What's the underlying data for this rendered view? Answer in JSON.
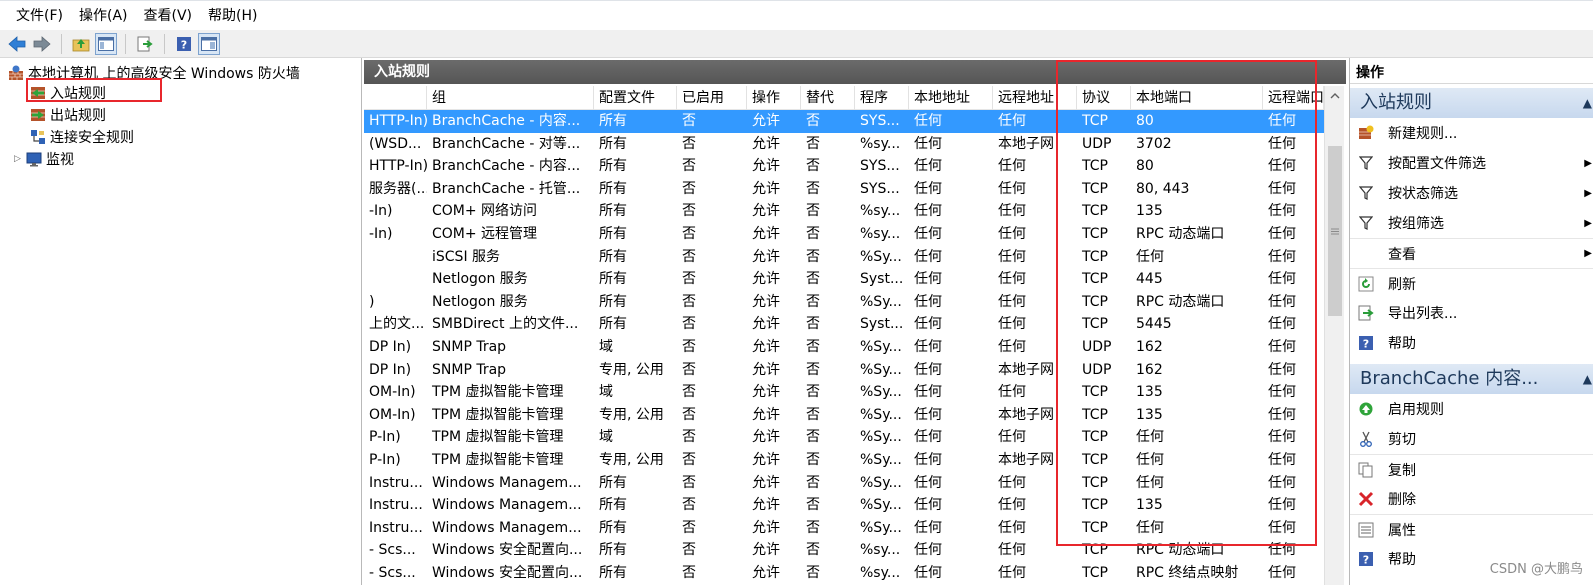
{
  "menubar": [
    "文件(F)",
    "操作(A)",
    "查看(V)",
    "帮助(H)"
  ],
  "tree": {
    "root": "本地计算机 上的高级安全 Windows 防火墙",
    "items": [
      "入站规则",
      "出站规则",
      "连接安全规则",
      "监视"
    ]
  },
  "center": {
    "title": "入站规则",
    "columns": [
      "组",
      "配置文件",
      "已启用",
      "操作",
      "替代",
      "程序",
      "本地地址",
      "远程地址",
      "协议",
      "本地端口",
      "远程端口"
    ],
    "rows": [
      {
        "name": "HTTP-In)",
        "group": "BranchCache - 内容...",
        "profile": "所有",
        "enabled": "否",
        "action": "允许",
        "override": "否",
        "program": "SYS...",
        "local_addr": "任何",
        "remote_addr": "任何",
        "protocol": "TCP",
        "local_port": "80",
        "remote_port": "任何",
        "selected": true
      },
      {
        "name": "(WSD...",
        "group": "BranchCache - 对等...",
        "profile": "所有",
        "enabled": "否",
        "action": "允许",
        "override": "否",
        "program": "%sy...",
        "local_addr": "任何",
        "remote_addr": "本地子网",
        "protocol": "UDP",
        "local_port": "3702",
        "remote_port": "任何"
      },
      {
        "name": "HTTP-In)",
        "group": "BranchCache - 内容...",
        "profile": "所有",
        "enabled": "否",
        "action": "允许",
        "override": "否",
        "program": "SYS...",
        "local_addr": "任何",
        "remote_addr": "任何",
        "protocol": "TCP",
        "local_port": "80",
        "remote_port": "任何"
      },
      {
        "name": "服务器(...",
        "group": "BranchCache - 托管...",
        "profile": "所有",
        "enabled": "否",
        "action": "允许",
        "override": "否",
        "program": "SYS...",
        "local_addr": "任何",
        "remote_addr": "任何",
        "protocol": "TCP",
        "local_port": "80, 443",
        "remote_port": "任何"
      },
      {
        "name": "-In)",
        "group": "COM+ 网络访问",
        "profile": "所有",
        "enabled": "否",
        "action": "允许",
        "override": "否",
        "program": "%sy...",
        "local_addr": "任何",
        "remote_addr": "任何",
        "protocol": "TCP",
        "local_port": "135",
        "remote_port": "任何"
      },
      {
        "name": "-In)",
        "group": "COM+ 远程管理",
        "profile": "所有",
        "enabled": "否",
        "action": "允许",
        "override": "否",
        "program": "%sy...",
        "local_addr": "任何",
        "remote_addr": "任何",
        "protocol": "TCP",
        "local_port": "RPC 动态端口",
        "remote_port": "任何"
      },
      {
        "name": "",
        "group": "iSCSI 服务",
        "profile": "所有",
        "enabled": "否",
        "action": "允许",
        "override": "否",
        "program": "%Sy...",
        "local_addr": "任何",
        "remote_addr": "任何",
        "protocol": "TCP",
        "local_port": "任何",
        "remote_port": "任何"
      },
      {
        "name": "",
        "group": "Netlogon 服务",
        "profile": "所有",
        "enabled": "否",
        "action": "允许",
        "override": "否",
        "program": "Syst...",
        "local_addr": "任何",
        "remote_addr": "任何",
        "protocol": "TCP",
        "local_port": "445",
        "remote_port": "任何"
      },
      {
        "name": ")",
        "group": "Netlogon 服务",
        "profile": "所有",
        "enabled": "否",
        "action": "允许",
        "override": "否",
        "program": "%Sy...",
        "local_addr": "任何",
        "remote_addr": "任何",
        "protocol": "TCP",
        "local_port": "RPC 动态端口",
        "remote_port": "任何"
      },
      {
        "name": "上的文...",
        "group": "SMBDirect 上的文件...",
        "profile": "所有",
        "enabled": "否",
        "action": "允许",
        "override": "否",
        "program": "Syst...",
        "local_addr": "任何",
        "remote_addr": "任何",
        "protocol": "TCP",
        "local_port": "5445",
        "remote_port": "任何"
      },
      {
        "name": "DP In)",
        "group": "SNMP Trap",
        "profile": "域",
        "enabled": "否",
        "action": "允许",
        "override": "否",
        "program": "%Sy...",
        "local_addr": "任何",
        "remote_addr": "任何",
        "protocol": "UDP",
        "local_port": "162",
        "remote_port": "任何"
      },
      {
        "name": "DP In)",
        "group": "SNMP Trap",
        "profile": "专用, 公用",
        "enabled": "否",
        "action": "允许",
        "override": "否",
        "program": "%Sy...",
        "local_addr": "任何",
        "remote_addr": "本地子网",
        "protocol": "UDP",
        "local_port": "162",
        "remote_port": "任何"
      },
      {
        "name": "OM-In)",
        "group": "TPM 虚拟智能卡管理",
        "profile": "域",
        "enabled": "否",
        "action": "允许",
        "override": "否",
        "program": "%Sy...",
        "local_addr": "任何",
        "remote_addr": "任何",
        "protocol": "TCP",
        "local_port": "135",
        "remote_port": "任何"
      },
      {
        "name": "OM-In)",
        "group": "TPM 虚拟智能卡管理",
        "profile": "专用, 公用",
        "enabled": "否",
        "action": "允许",
        "override": "否",
        "program": "%Sy...",
        "local_addr": "任何",
        "remote_addr": "本地子网",
        "protocol": "TCP",
        "local_port": "135",
        "remote_port": "任何"
      },
      {
        "name": "P-In)",
        "group": "TPM 虚拟智能卡管理",
        "profile": "域",
        "enabled": "否",
        "action": "允许",
        "override": "否",
        "program": "%Sy...",
        "local_addr": "任何",
        "remote_addr": "任何",
        "protocol": "TCP",
        "local_port": "任何",
        "remote_port": "任何"
      },
      {
        "name": "P-In)",
        "group": "TPM 虚拟智能卡管理",
        "profile": "专用, 公用",
        "enabled": "否",
        "action": "允许",
        "override": "否",
        "program": "%Sy...",
        "local_addr": "任何",
        "remote_addr": "本地子网",
        "protocol": "TCP",
        "local_port": "任何",
        "remote_port": "任何"
      },
      {
        "name": "Instru...",
        "group": "Windows Managem...",
        "profile": "所有",
        "enabled": "否",
        "action": "允许",
        "override": "否",
        "program": "%Sy...",
        "local_addr": "任何",
        "remote_addr": "任何",
        "protocol": "TCP",
        "local_port": "任何",
        "remote_port": "任何"
      },
      {
        "name": "Instru...",
        "group": "Windows Managem...",
        "profile": "所有",
        "enabled": "否",
        "action": "允许",
        "override": "否",
        "program": "%Sy...",
        "local_addr": "任何",
        "remote_addr": "任何",
        "protocol": "TCP",
        "local_port": "135",
        "remote_port": "任何"
      },
      {
        "name": "Instru...",
        "group": "Windows Managem...",
        "profile": "所有",
        "enabled": "否",
        "action": "允许",
        "override": "否",
        "program": "%Sy...",
        "local_addr": "任何",
        "remote_addr": "任何",
        "protocol": "TCP",
        "local_port": "任何",
        "remote_port": "任何"
      },
      {
        "name": "- Scs...",
        "group": "Windows 安全配置向...",
        "profile": "所有",
        "enabled": "否",
        "action": "允许",
        "override": "否",
        "program": "%sy...",
        "local_addr": "任何",
        "remote_addr": "任何",
        "protocol": "TCP",
        "local_port": "RPC 动态端口",
        "remote_port": "任何"
      },
      {
        "name": "- Scs...",
        "group": "Windows 安全配置向...",
        "profile": "所有",
        "enabled": "否",
        "action": "允许",
        "override": "否",
        "program": "%sy...",
        "local_addr": "任何",
        "remote_addr": "任何",
        "protocol": "TCP",
        "local_port": "RPC 终结点映射",
        "remote_port": "任何"
      }
    ]
  },
  "actions": {
    "title": "操作",
    "section1": "入站规则",
    "section1_items": [
      "新建规则...",
      "按配置文件筛选",
      "按状态筛选",
      "按组筛选",
      "查看",
      "刷新",
      "导出列表...",
      "帮助"
    ],
    "section2": "BranchCache 内容...",
    "section2_items": [
      "启用规则",
      "剪切",
      "复制",
      "删除",
      "属性",
      "帮助"
    ]
  },
  "watermark": "CSDN @大鹏鸟",
  "colors": {
    "selection": "#3399ff",
    "highlight_box": "#e8262c",
    "section_bg": "#c7d8ee"
  },
  "icons": {
    "toolbar": [
      "back-icon",
      "forward-icon",
      "folder-up-icon",
      "show-hide-tree-icon",
      "export-icon",
      "help-icon",
      "show-hide-action-icon"
    ],
    "tree": [
      "firewall-icon",
      "inbound-rules-icon",
      "outbound-rules-icon",
      "connection-security-icon",
      "monitor-icon"
    ],
    "actions": [
      "new-rule-icon",
      "filter-icon",
      "filter-icon",
      "filter-icon",
      "view-icon",
      "refresh-icon",
      "export-icon",
      "help-icon",
      "enable-icon",
      "cut-icon",
      "copy-icon",
      "delete-icon",
      "properties-icon",
      "help-icon"
    ]
  }
}
